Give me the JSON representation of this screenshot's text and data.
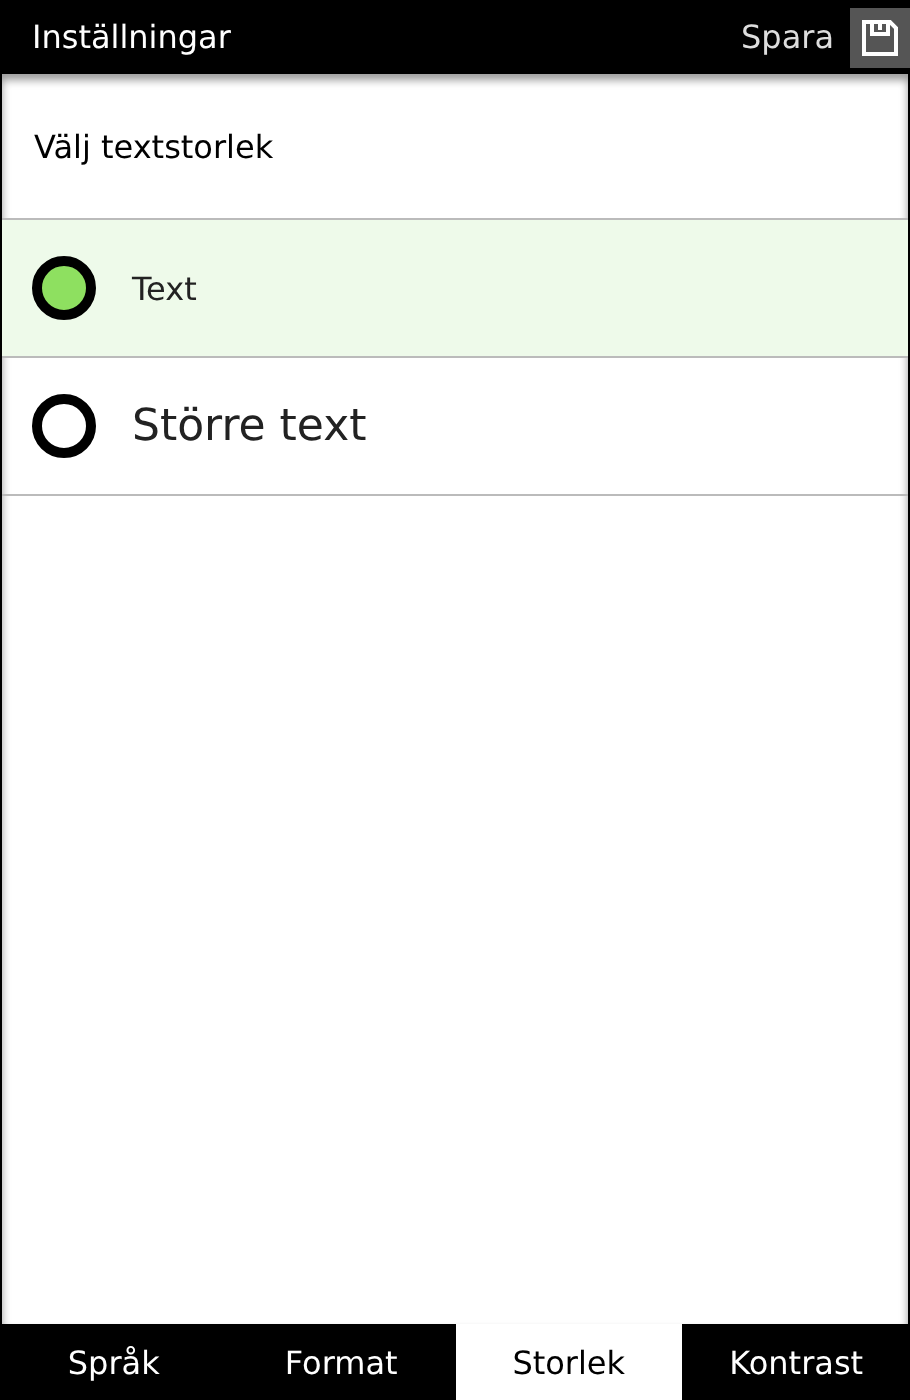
{
  "header": {
    "title": "Inställningar",
    "save_label": "Spara"
  },
  "heading": "Välj textstorlek",
  "options": [
    {
      "label": "Text",
      "kind": "normal",
      "selected": true
    },
    {
      "label": "Större text",
      "kind": "large",
      "selected": false
    }
  ],
  "tabs": [
    {
      "label": "Språk",
      "selected": false
    },
    {
      "label": "Format",
      "selected": false
    },
    {
      "label": "Storlek",
      "selected": true
    },
    {
      "label": "Kontrast",
      "selected": false
    }
  ]
}
